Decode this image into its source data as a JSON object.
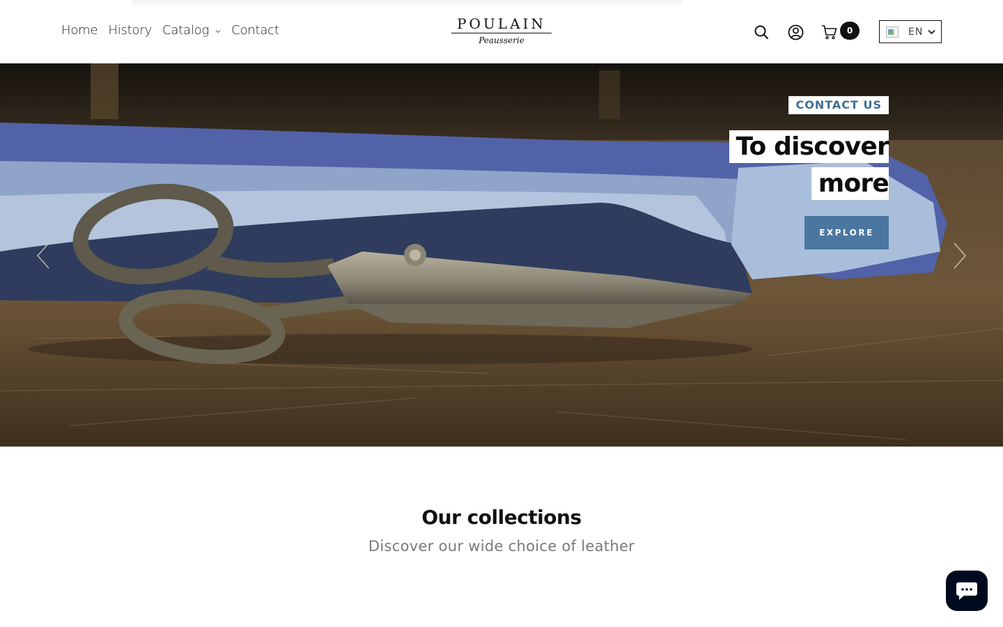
{
  "header": {
    "nav": [
      {
        "label": "Home"
      },
      {
        "label": "History"
      },
      {
        "label": "Catalog",
        "has_dropdown": true
      },
      {
        "label": "Contact"
      }
    ],
    "logo": {
      "title": "POULAIN",
      "subtitle": "Peausserie"
    },
    "icons": {
      "search": "search-icon",
      "account": "user-icon",
      "cart": "cart-icon"
    },
    "cart_count": "0",
    "language": {
      "selected": "EN",
      "flag": "flag-icon"
    }
  },
  "hero": {
    "tag": "CONTACT US",
    "headline": [
      "To discover",
      "more"
    ],
    "button_label": "EXPLORE",
    "accent_color": "#4a76a0"
  },
  "collections": {
    "title": "Our collections",
    "subtitle": "Discover our wide choice of leather"
  },
  "chat": {
    "icon": "chat-icon",
    "color": "#000a1e"
  }
}
